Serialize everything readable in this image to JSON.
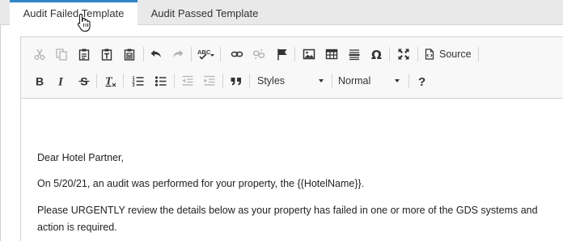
{
  "tabs": [
    {
      "label": "Audit Failed Template",
      "active": true
    },
    {
      "label": "Audit Passed Template",
      "active": false
    }
  ],
  "toolbar": {
    "source_label": "Source",
    "styles_label": "Styles",
    "format_label": "Normal",
    "icons_row1": [
      "cut-icon",
      "copy-icon",
      "paste-icon",
      "paste-text-icon",
      "paste-word-icon",
      "undo-icon",
      "redo-icon",
      "spellcheck-icon",
      "link-icon",
      "unlink-icon",
      "anchor-icon",
      "image-icon",
      "table-icon",
      "horizontal-line-icon",
      "special-char-icon",
      "maximize-icon",
      "source-icon"
    ],
    "icons_row2": [
      "bold-icon",
      "italic-icon",
      "strikethrough-icon",
      "remove-format-icon",
      "numbered-list-icon",
      "bulleted-list-icon",
      "outdent-icon",
      "indent-icon",
      "blockquote-icon",
      "help-icon"
    ]
  },
  "content": {
    "greeting": "Dear Hotel Partner,",
    "line1": "On 5/20/21, an audit was performed for your property, the {{HotelName}}.",
    "line2": "Please URGENTLY review the details below as your property has failed in one or more of the GDS systems and",
    "line3": "action is required."
  },
  "colors": {
    "active_tab_accent": "#2f86c8",
    "tabbar_bg": "#e9e9e9",
    "toolbar_bg": "#f8f8f8"
  }
}
